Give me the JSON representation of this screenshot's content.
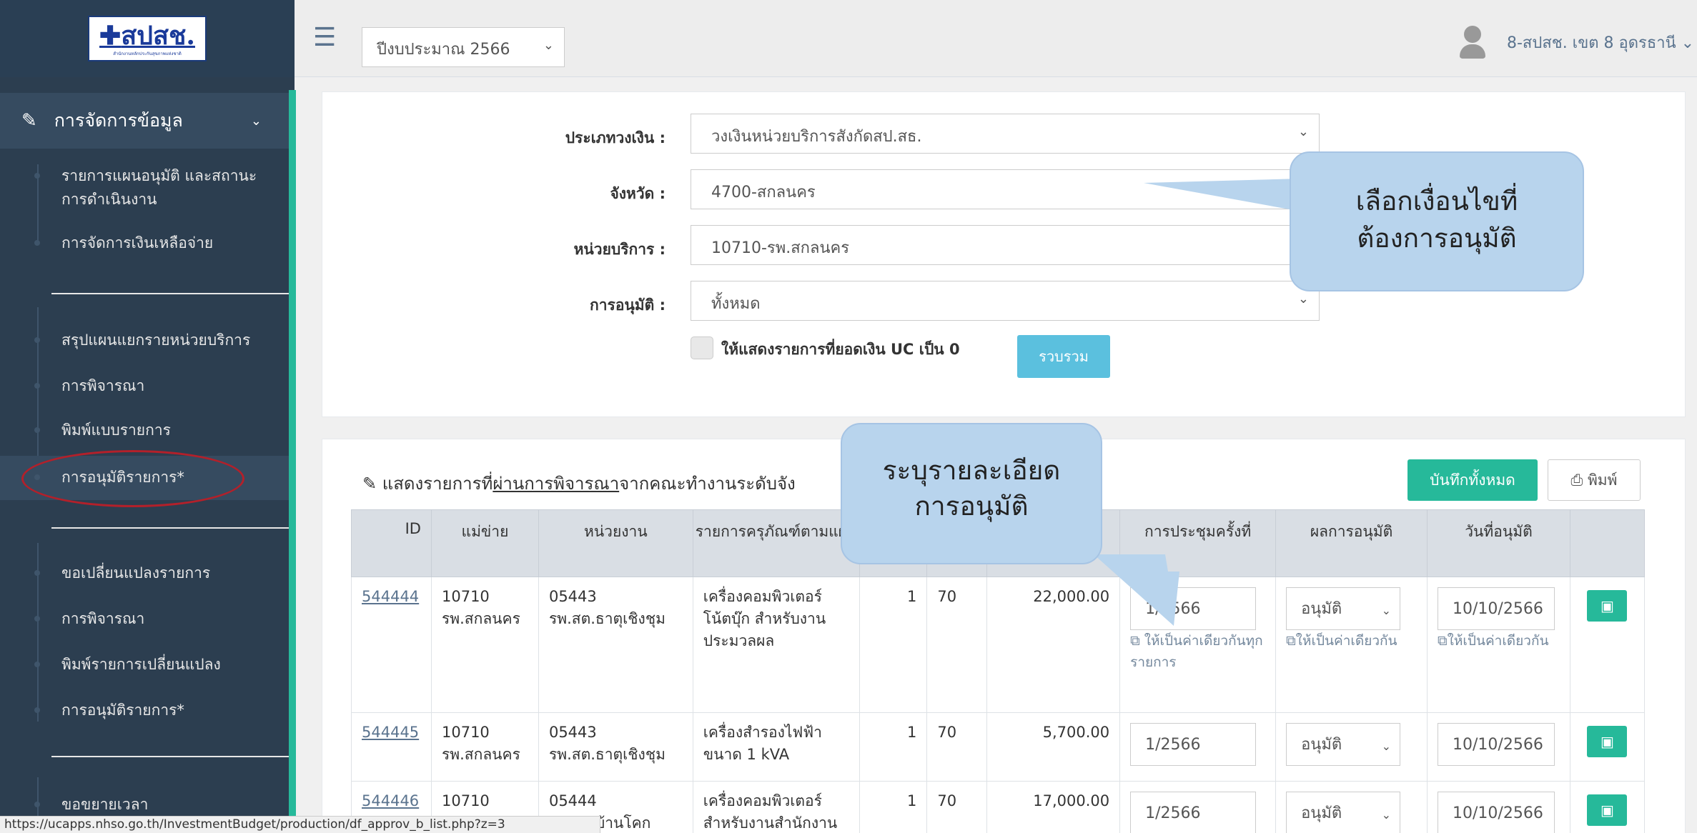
{
  "logo": {
    "text": "สปสช.",
    "sub": "สำนักงานหลักประกันสุขภาพแห่งชาติ"
  },
  "topbar": {
    "year": "ปีงบประมาณ 2566",
    "user": "8-สปสช. เขต 8 อุดรธานี ⌄"
  },
  "sidebar": {
    "section": "การจัดการข้อมูล",
    "items": [
      "รายการแผนอนุมัติ และสถานะการดำเนินงาน",
      "การจัดการเงินเหลือจ่าย",
      "สรุปแผนแยกรายหน่วยบริการ",
      "การพิจารณา",
      "พิมพ์แบบรายการ",
      "การอนุมัติรายการ*",
      "ขอเปลี่ยนแปลงรายการ",
      "การพิจารณา",
      "พิมพ์รายการเปลี่ยนแปลง",
      "การอนุมัติรายการ*",
      "ขอขยายเวลา"
    ]
  },
  "filters": {
    "fund_type_label": "ประเภทวงเงิน :",
    "fund_type": "วงเงินหน่วยบริการสังกัดสป.สธ.",
    "province_label": "จังหวัด :",
    "province": "4700-สกลนคร",
    "unit_label": "หน่วยบริการ :",
    "unit": "10710-รพ.สกลนคร",
    "approval_label": "การอนุมัติ :",
    "approval": "ทั้งหมด",
    "zero_uc_label": "ให้แสดงรายการที่ยอดเงิน UC เป็น 0",
    "collect_button": "รวบรวม"
  },
  "list": {
    "title_prefix": "แสดงรายการที่",
    "title_link": "ผ่านการพิจารณา",
    "title_suffix": "จากคณะทำงานระดับจัง",
    "save_all": "บันทึกทั้งหมด",
    "print": "พิมพ์"
  },
  "table": {
    "headers": [
      "ID",
      "แม่ข่าย",
      "หน่วยงาน",
      "รายการครุภัณฑ์ตามแผน",
      "",
      "",
      "",
      "การประชุมครั้งที่",
      "ผลการอนุมัติ",
      "วันที่อนุมัติ",
      ""
    ],
    "copy_meeting": "ให้เป็นค่าเดียวกันทุกรายการ",
    "copy_result": "ให้เป็นค่าเดียวกัน",
    "copy_date": "ให้เป็นค่าเดียวกัน",
    "rows": [
      {
        "id": "544444",
        "host_code": "10710",
        "host_name": "รพ.สกลนคร",
        "unit_code": "05443",
        "unit_name": "รพ.สต.ธาตุเชิงชุม",
        "item": "เครื่องคอมพิวเตอร์โน้ตบุ๊ก สำหรับงานประมวลผล",
        "qty": "1",
        "pct": "70",
        "amount": "22,000.00",
        "meeting": "1/2566",
        "result": "อนุมัติ",
        "date": "10/10/2566"
      },
      {
        "id": "544445",
        "host_code": "10710",
        "host_name": "รพ.สกลนคร",
        "unit_code": "05443",
        "unit_name": "รพ.สต.ธาตุเชิงชุม",
        "item": "เครื่องสำรองไฟฟ้า ขนาด 1 kVA",
        "qty": "1",
        "pct": "70",
        "amount": "5,700.00",
        "meeting": "1/2566",
        "result": "อนุมัติ",
        "date": "10/10/2566"
      },
      {
        "id": "544446",
        "host_code": "10710",
        "host_name": "",
        "unit_code": "05444",
        "unit_name": "รพ.สต.บ้านโคก",
        "item": "เครื่องคอมพิวเตอร์ สำหรับงานสำนักงาน",
        "qty": "1",
        "pct": "70",
        "amount": "17,000.00",
        "meeting": "1/2566",
        "result": "อนุมัติ",
        "date": "10/10/2566"
      }
    ]
  },
  "callouts": {
    "select_conditions_1": "เลือกเงื่อนไขที่",
    "select_conditions_2": "ต้องการอนุมัติ",
    "specify_details_1": "ระบุรายละเอียด",
    "specify_details_2": "การอนุมัติ"
  },
  "statusbar": "https://ucapps.nhso.go.th/InvestmentBudget/production/df_approv_b_list.php?z=3",
  "colors": {
    "sidebar": "#2c3e50",
    "accent": "#26b99a",
    "info": "#5bc0de",
    "callout": "#b8d4ed",
    "highlight": "#b3202a"
  }
}
